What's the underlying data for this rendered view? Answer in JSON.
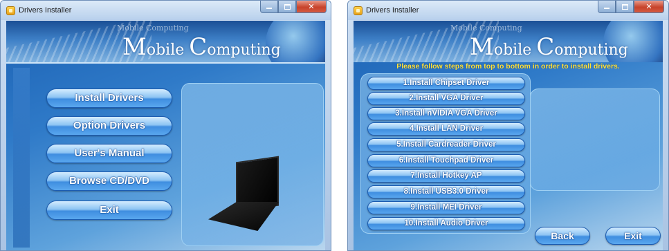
{
  "left_window": {
    "title": "Drivers Installer",
    "banner": {
      "small_text": "Mobile Computing",
      "title_m": "M",
      "title_rest_1": "obile ",
      "title_c": "C",
      "title_rest_2": "omputing"
    },
    "menu": [
      "Install Drivers",
      "Option Drivers",
      "User's Manual",
      "Browse CD/DVD",
      "Exit"
    ],
    "image_icon": "laptop-icon"
  },
  "right_window": {
    "title": "Drivers Installer",
    "banner": {
      "small_text": "Mobile Computing",
      "title_m": "M",
      "title_rest_1": "obile ",
      "title_c": "C",
      "title_rest_2": "omputing"
    },
    "instruction": "Please follow steps from top to bottom in order to install drivers.",
    "steps": [
      "1.Install Chipset Driver",
      "2.Install VGA Driver",
      "3.Install nVIDIA VGA Driver",
      "4.Install LAN Driver",
      "5.Install Cardreader Driver",
      "6.Install Touchpad Driver",
      "7.Install Hotkey AP",
      "8.Install USB3.0 Driver",
      "9.Install MEI Driver",
      "10.Install Audio Driver"
    ],
    "back_label": "Back",
    "exit_label": "Exit"
  },
  "icons": [
    "app-icon",
    "minimize-icon",
    "maximize-icon",
    "close-icon"
  ],
  "colors": {
    "instruction_text": "#ffe23a",
    "button_text": "#ffffff",
    "close_button": "#c7432b"
  }
}
